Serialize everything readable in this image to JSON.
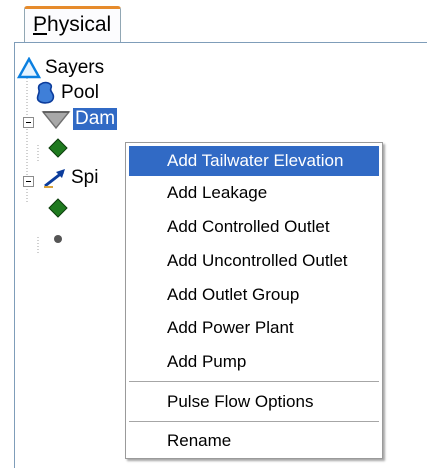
{
  "tab": {
    "label": "Physical",
    "accel_letter": "P",
    "rest": "hysical"
  },
  "tree": {
    "root": {
      "label": "Sayers",
      "icon": "reservoir-triangle-icon"
    },
    "pool": {
      "label": "Pool",
      "icon": "pool-icon"
    },
    "dam": {
      "label": "Dam",
      "icon": "dam-icon",
      "selected": true
    },
    "spillway": {
      "label": "Spi",
      "icon": "spillway-arrow-icon"
    }
  },
  "menu": {
    "items": [
      {
        "label": "Add Tailwater Elevation",
        "highlighted": true
      },
      {
        "label": "Add Leakage"
      },
      {
        "label": "Add Controlled Outlet"
      },
      {
        "label": "Add Uncontrolled Outlet"
      },
      {
        "label": "Add Outlet Group"
      },
      {
        "label": "Add Power Plant"
      },
      {
        "label": "Add Pump"
      },
      {
        "label": "Pulse Flow Options"
      },
      {
        "label": "Rename"
      }
    ]
  },
  "colors": {
    "selection": "#316ac5",
    "tab_accent": "#e68b2c",
    "node_green": "#1f7a1f",
    "root_blue": "#0a7fe0"
  }
}
